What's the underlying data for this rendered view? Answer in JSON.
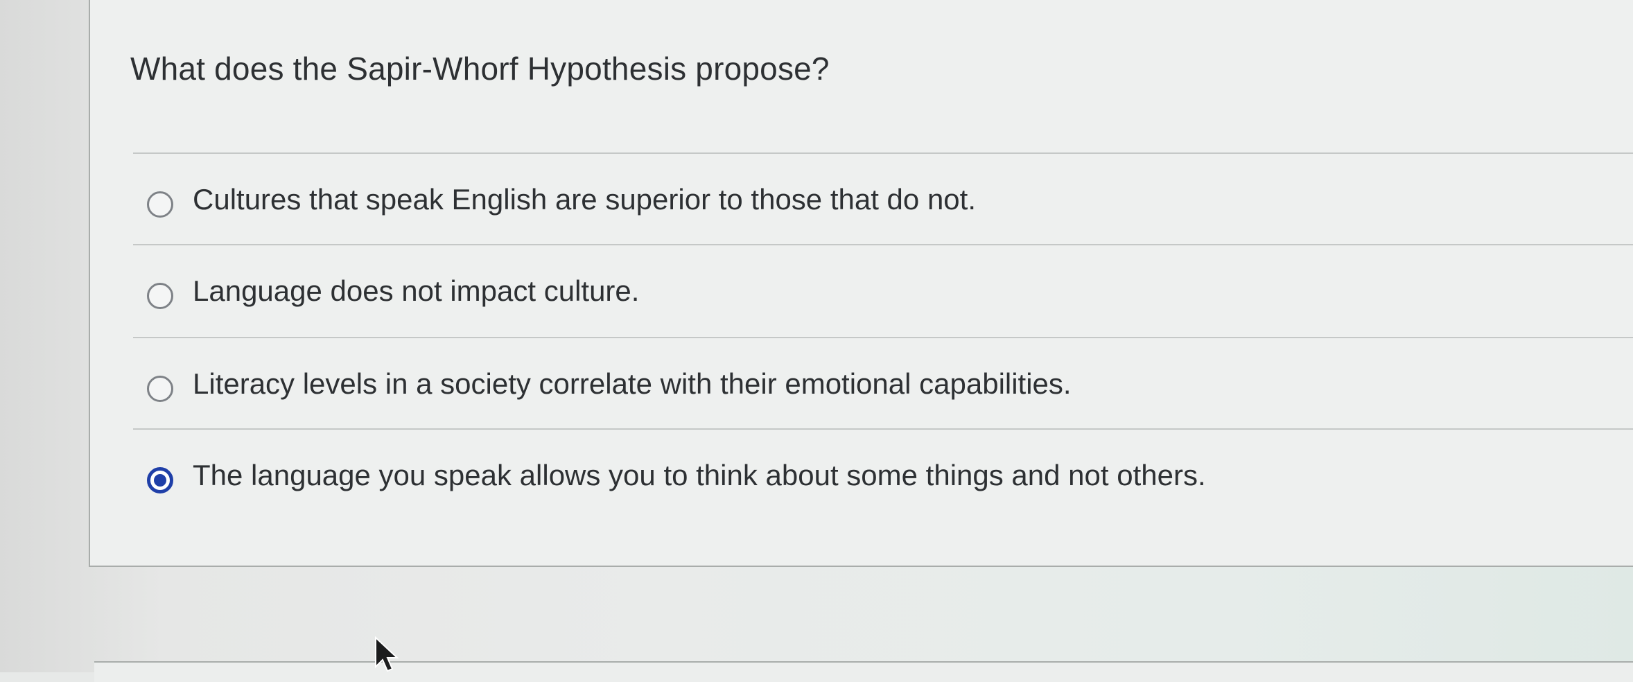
{
  "question": {
    "text": "What does the Sapir-Whorf Hypothesis propose?"
  },
  "options": [
    {
      "label": "Cultures that speak English are superior to those that do not.",
      "selected": false
    },
    {
      "label": "Language does not impact culture.",
      "selected": false
    },
    {
      "label": "Literacy levels in a society correlate with their emotional capabilities.",
      "selected": false
    },
    {
      "label": "The language you speak allows you to think about some things and not others.",
      "selected": true
    }
  ],
  "colors": {
    "text": "#2d3033",
    "selected_radio": "#1f3fa8",
    "divider": "#c5c8c7",
    "card_border": "#a9adab"
  },
  "icons": {
    "cursor": "mouse-pointer-icon"
  }
}
